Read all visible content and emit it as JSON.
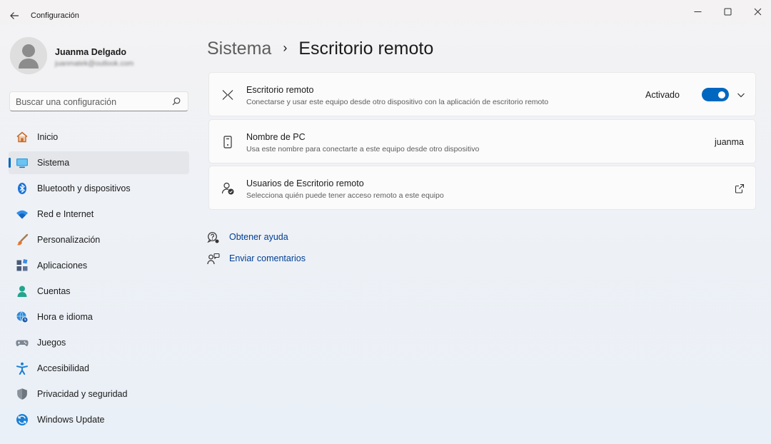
{
  "window": {
    "title": "Configuración",
    "back_icon": "back-arrow-icon",
    "controls": [
      "minimize-icon",
      "maximize-icon",
      "close-icon"
    ]
  },
  "user": {
    "name": "Juanma Delgado",
    "email": "juanmatek@outlook.com"
  },
  "search": {
    "placeholder": "Buscar una configuración",
    "icon": "search-icon"
  },
  "sidebar": {
    "items": [
      {
        "label": "Inicio",
        "icon": "home-icon",
        "selected": false
      },
      {
        "label": "Sistema",
        "icon": "monitor-icon",
        "selected": true
      },
      {
        "label": "Bluetooth y dispositivos",
        "icon": "bluetooth-icon",
        "selected": false
      },
      {
        "label": "Red e Internet",
        "icon": "wifi-icon",
        "selected": false
      },
      {
        "label": "Personalización",
        "icon": "brush-icon",
        "selected": false
      },
      {
        "label": "Aplicaciones",
        "icon": "apps-icon",
        "selected": false
      },
      {
        "label": "Cuentas",
        "icon": "account-icon",
        "selected": false
      },
      {
        "label": "Hora e idioma",
        "icon": "globe-clock-icon",
        "selected": false
      },
      {
        "label": "Juegos",
        "icon": "gamepad-icon",
        "selected": false
      },
      {
        "label": "Accesibilidad",
        "icon": "accessibility-icon",
        "selected": false
      },
      {
        "label": "Privacidad y seguridad",
        "icon": "shield-icon",
        "selected": false
      },
      {
        "label": "Windows Update",
        "icon": "update-icon",
        "selected": false
      }
    ]
  },
  "breadcrumb": {
    "parent": "Sistema",
    "separator": "›",
    "current": "Escritorio remoto"
  },
  "cards": {
    "remote_desktop": {
      "title": "Escritorio remoto",
      "description": "Conectarse y usar este equipo desde otro dispositivo con la aplicación de escritorio remoto",
      "status": "Activado",
      "toggle_on": true
    },
    "pc_name": {
      "title": "Nombre de PC",
      "description": "Usa este nombre para conectarte a este equipo desde otro dispositivo",
      "value": "juanma"
    },
    "users": {
      "title": "Usuarios de Escritorio remoto",
      "description": "Selecciona quién puede tener acceso remoto a este equipo"
    }
  },
  "links": {
    "help": "Obtener ayuda",
    "feedback": "Enviar comentarios"
  },
  "colors": {
    "accent": "#0067c0",
    "link": "#003e92"
  }
}
